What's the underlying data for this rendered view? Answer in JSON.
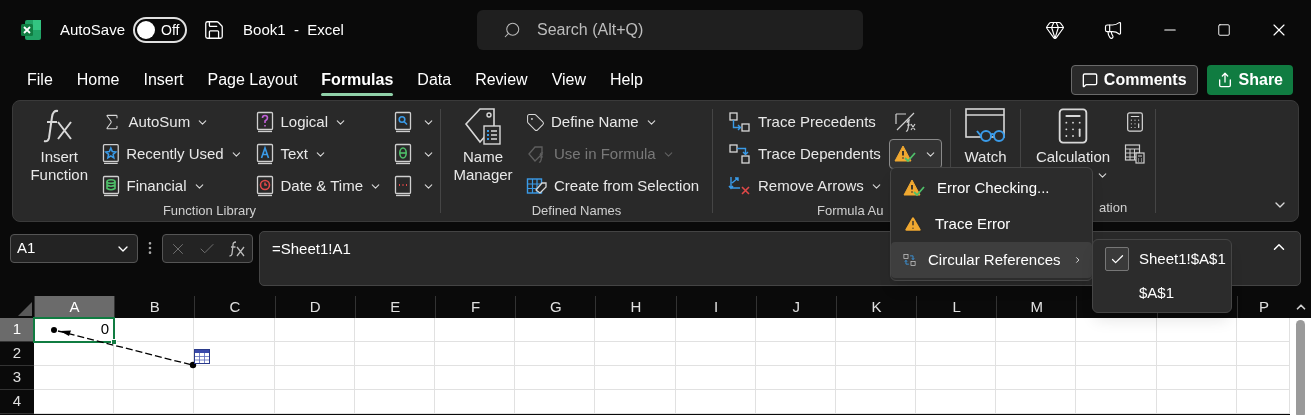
{
  "title_bar": {
    "autosave_label": "AutoSave",
    "autosave": {
      "on": false,
      "label": "Off"
    },
    "title": "Book1  -  Excel",
    "search": {
      "placeholder": "Search (Alt+Q)"
    }
  },
  "tabs": [
    {
      "label": "File",
      "selected": false
    },
    {
      "label": "Home",
      "selected": false
    },
    {
      "label": "Insert",
      "selected": false
    },
    {
      "label": "Page Layout",
      "selected": false
    },
    {
      "label": "Formulas",
      "selected": true
    },
    {
      "label": "Data",
      "selected": false
    },
    {
      "label": "Review",
      "selected": false
    },
    {
      "label": "View",
      "selected": false
    },
    {
      "label": "Help",
      "selected": false
    }
  ],
  "header_buttons": [
    {
      "label": "Comments",
      "kind": "comments"
    },
    {
      "label": "Share",
      "kind": "share"
    }
  ],
  "ribbon": {
    "groups": [
      {
        "label": "Function Library",
        "large": [
          {
            "label": "Insert Function",
            "kind": "fx",
            "dropdown": false
          }
        ],
        "items": [
          {
            "label": "AutoSum",
            "kind": "sum",
            "dropdown": true,
            "disabled": false,
            "expanded": false
          },
          {
            "label": "Recently Used",
            "kind": "star",
            "dropdown": true,
            "disabled": false,
            "expanded": false
          },
          {
            "label": "Financial",
            "kind": "financial",
            "dropdown": true,
            "disabled": false,
            "expanded": false
          },
          {
            "label": "Logical",
            "kind": "logical",
            "dropdown": true,
            "disabled": false,
            "expanded": false
          },
          {
            "label": "Text",
            "kind": "text",
            "dropdown": true,
            "disabled": false,
            "expanded": false
          },
          {
            "label": "Date & Time",
            "kind": "datetime",
            "dropdown": true,
            "disabled": false,
            "expanded": false
          },
          {
            "kind": "lookup",
            "dropdown": true,
            "disabled": false,
            "expanded": false
          },
          {
            "kind": "math",
            "dropdown": true,
            "disabled": false,
            "expanded": false
          },
          {
            "kind": "more",
            "dropdown": true,
            "disabled": false,
            "expanded": false
          }
        ]
      },
      {
        "label": "Defined Names",
        "large": [
          {
            "label": "Name Manager",
            "kind": "name_manager",
            "dropdown": false
          }
        ],
        "items": [
          {
            "label": "Define Name",
            "kind": "tag",
            "dropdown": true,
            "disabled": false,
            "expanded": false
          },
          {
            "label": "Use in Formula",
            "kind": "use_formula",
            "dropdown": true,
            "disabled": true,
            "expanded": false
          },
          {
            "label": "Create from Selection",
            "kind": "create",
            "dropdown": false,
            "disabled": false,
            "expanded": false
          }
        ]
      },
      {
        "label": "Formula Au",
        "items": [
          {
            "label": "Trace Precedents",
            "kind": "precedents",
            "dropdown": false,
            "disabled": false,
            "expanded": false
          },
          {
            "label": "Trace Dependents",
            "kind": "dependents",
            "dropdown": false,
            "disabled": false,
            "expanded": false
          },
          {
            "label": "Remove Arrows",
            "kind": "remove_arrows",
            "dropdown": true,
            "disabled": false,
            "expanded": false
          },
          {
            "kind": "show_formulas",
            "dropdown": false,
            "disabled": false,
            "expanded": false
          },
          {
            "kind": "error_check",
            "dropdown": true,
            "disabled": false,
            "expanded": true
          }
        ]
      },
      {
        "large": [
          {
            "label": "Watch",
            "kind": "watch"
          }
        ]
      },
      {
        "label": "ation",
        "large": [
          {
            "label": "Calculation",
            "kind": "calculator",
            "dropdown": true
          }
        ],
        "items": [
          {
            "kind": "calc_now",
            "dropdown": false,
            "disabled": false,
            "expanded": false
          },
          {
            "kind": "calc_sheet",
            "dropdown": false,
            "disabled": false,
            "expanded": false
          }
        ]
      }
    ]
  },
  "name_box": {
    "value": "A1"
  },
  "formula": {
    "value": "=Sheet1!A1"
  },
  "sheet": {
    "columns": [
      {
        "label": "A",
        "selected": true
      },
      {
        "label": "B",
        "selected": false
      },
      {
        "label": "C",
        "selected": false
      },
      {
        "label": "D",
        "selected": false
      },
      {
        "label": "E",
        "selected": false
      },
      {
        "label": "F",
        "selected": false
      },
      {
        "label": "G",
        "selected": false
      },
      {
        "label": "H",
        "selected": false
      },
      {
        "label": "I",
        "selected": false
      },
      {
        "label": "J",
        "selected": false
      },
      {
        "label": "K",
        "selected": false
      },
      {
        "label": "L",
        "selected": false
      },
      {
        "label": "M",
        "selected": false
      },
      {},
      {},
      {
        "label": "P",
        "selected": false
      }
    ],
    "rows": [
      {
        "label": "1",
        "selected": true,
        "cells": [
          "0"
        ]
      },
      {
        "label": "2",
        "selected": false
      },
      {
        "label": "3",
        "selected": false
      },
      {
        "label": "4",
        "selected": false
      }
    ]
  },
  "menu": {
    "items": [
      {
        "label": "Error Checking...",
        "kind": "error_checking",
        "selected": false,
        "submenu": false
      },
      {
        "label": "Trace Error",
        "kind": "trace_error",
        "selected": false,
        "submenu": false
      },
      {
        "label": "Circular References",
        "kind": "circular",
        "selected": true,
        "submenu": true
      }
    ]
  },
  "submenu": {
    "items": [
      {
        "label": "Sheet1!$A$1",
        "checked": true
      },
      {
        "label": "$A$1",
        "checked": false
      }
    ]
  }
}
